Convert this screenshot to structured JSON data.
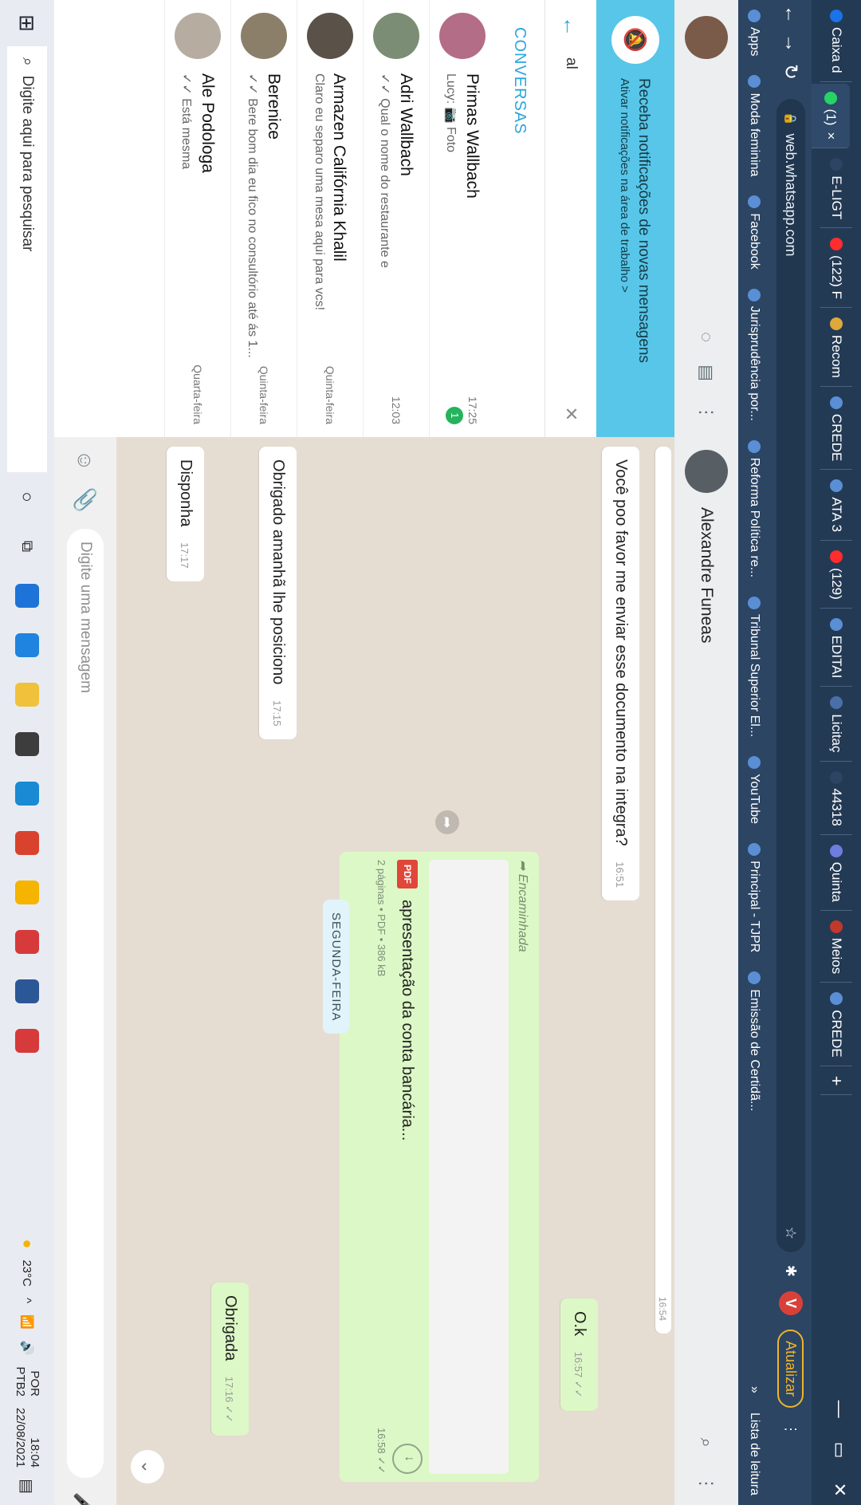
{
  "tabs": [
    {
      "label": "Caixa d",
      "color": "#1a73e8",
      "icon": "gmail-icon"
    },
    {
      "label": "(1)",
      "color": "#25d366",
      "icon": "whatsapp-icon",
      "active": true
    },
    {
      "label": "E-LIGT",
      "color": "#2c4563",
      "icon": "globe-icon"
    },
    {
      "label": "(122) F",
      "color": "#ff2d2d",
      "icon": "youtube-icon"
    },
    {
      "label": "Recom",
      "color": "#e0a83a",
      "icon": "site-icon"
    },
    {
      "label": "CREDE",
      "color": "#5a8fd6",
      "icon": "site-icon"
    },
    {
      "label": "ATA 3",
      "color": "#5a8fd6",
      "icon": "site-icon"
    },
    {
      "label": "(129)",
      "color": "#ff2d2d",
      "icon": "youtube-icon"
    },
    {
      "label": "EDITAI",
      "color": "#5a8fd6",
      "icon": "site-icon"
    },
    {
      "label": "Licitaç",
      "color": "#4a6fa8",
      "icon": "site-icon"
    },
    {
      "label": "44318",
      "color": "#2c4563",
      "icon": "globe-icon"
    },
    {
      "label": "Quinta",
      "color": "#6d7ee0",
      "icon": "site-icon"
    },
    {
      "label": "Meios",
      "color": "#c0392b",
      "icon": "acrobat-icon"
    },
    {
      "label": "CREDE",
      "color": "#5a8fd6",
      "icon": "site-icon"
    }
  ],
  "tab_close": "×",
  "new_tab": "+",
  "window": {
    "minimize": "—",
    "restore": "▭",
    "close": "✕"
  },
  "address": {
    "url": "web.whatsapp.com",
    "update_label": "Atualizar",
    "profile_letter": "V",
    "reading_list": "Lista de leitura"
  },
  "bookmarks": [
    {
      "label": "Apps",
      "icon": "apps-icon"
    },
    {
      "label": "Moda feminina",
      "icon": "globe-icon"
    },
    {
      "label": "Facebook",
      "icon": "facebook-icon"
    },
    {
      "label": "Jurisprudência por...",
      "icon": "site-icon"
    },
    {
      "label": "Reforma Política re...",
      "icon": "site-icon"
    },
    {
      "label": "Tribunal Superior El...",
      "icon": "site-icon"
    },
    {
      "label": "YouTube",
      "icon": "youtube-icon"
    },
    {
      "label": "Principal - TJPR",
      "icon": "site-icon"
    },
    {
      "label": "Emissão de Certidã...",
      "icon": "site-icon"
    }
  ],
  "bookmarks_more": "»",
  "notification": {
    "title": "Receba notificações de novas mensagens",
    "subtitle": "Ativar notificações na área de trabalho >"
  },
  "search": {
    "query": "al"
  },
  "section_title": "CONVERSAS",
  "chats": [
    {
      "name": "Primas Wallbach",
      "preview": "Lucy: 📷 Foto",
      "time": "17:25",
      "badge": "1",
      "avatar": "#b46d86"
    },
    {
      "name": "Adri Wallbach",
      "preview": "✓✓ Qual o nome do restaurante e",
      "time": "12:03",
      "avatar": "#7b8d74"
    },
    {
      "name": "Armazen Califórnia Khalil",
      "preview": "Claro eu separo uma mesa aqui para vcs!",
      "time": "Quinta-feira",
      "avatar": "#5a5148"
    },
    {
      "name": "Berenice",
      "preview": "✓✓ Bere bom dia eu fico no consultório até ás 1...",
      "time": "Quinta-feira",
      "avatar": "#8c7f6a"
    },
    {
      "name": "Ale Podologa",
      "preview": "✓✓ Está mesma",
      "time": "Quarta-feira",
      "avatar": "#b6aca0"
    }
  ],
  "contact": {
    "name": "Alexandre Funeas"
  },
  "messages": [
    {
      "text": "Você poo favor me enviar esse documento na integra?",
      "time": "16:51",
      "dir": "in"
    },
    {
      "text": "O.k",
      "time": "16:57 ✓✓",
      "dir": "out"
    },
    {
      "text": "Obrigado amanhã lhe posiciono",
      "time": "17:15",
      "dir": "in"
    },
    {
      "text": "Disponha",
      "time": "17:17",
      "dir": "in"
    },
    {
      "text": "Obrigada",
      "time": "17:16 ✓✓",
      "dir": "out"
    }
  ],
  "partial_time": "16:54",
  "day_label": "SEGUNDA-FEIRA",
  "document": {
    "forwarded": "➦ Encaminhada",
    "name": "apresentação da conta bancária...",
    "badge": "PDF",
    "meta": "2 páginas • PDF • 386 kB",
    "time": "16:58 ✓✓"
  },
  "composer": {
    "placeholder": "Digite uma mensagem"
  },
  "taskbar": {
    "search_placeholder": "Digite aqui para pesquisar",
    "weather": "23°C",
    "lang1": "POR",
    "lang2": "PTB2",
    "time": "18:04",
    "date": "22/08/2021"
  },
  "taskbar_apps": [
    "#1e73d8",
    "#1f84e0",
    "#f0c13a",
    "#3d3d3d",
    "#1a8ad4",
    "#d9432e",
    "#f4b400",
    "#d63a3a",
    "#2b5797",
    "#d63a3a"
  ]
}
